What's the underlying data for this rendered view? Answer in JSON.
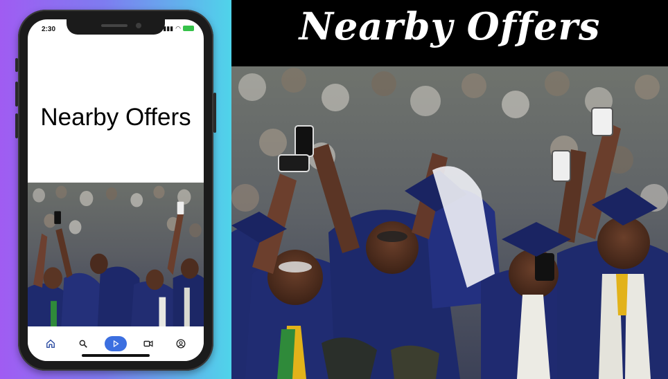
{
  "status_bar": {
    "time": "2:30"
  },
  "phone": {
    "title": "Nearby Offers"
  },
  "bottom_nav": [
    {
      "icon": "home-icon",
      "active": false
    },
    {
      "icon": "search-icon",
      "active": false
    },
    {
      "icon": "play-icon",
      "active": true
    },
    {
      "icon": "video-icon",
      "active": false
    },
    {
      "icon": "account-icon",
      "active": false
    }
  ],
  "banner": {
    "title": "Nearby Offers"
  },
  "colors": {
    "gradient_start": "#a05cf2",
    "gradient_end": "#4fd4ea",
    "nav_active": "#3c6fe0",
    "gown": "#1f2a6b"
  }
}
